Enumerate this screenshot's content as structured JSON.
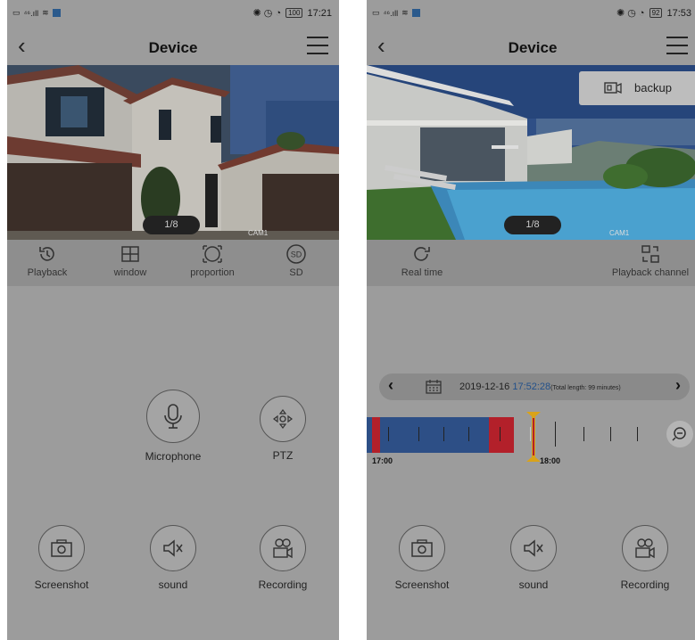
{
  "left": {
    "status_bar": {
      "signal": "⁴⁶.ıll",
      "time": "17:21",
      "battery": "100"
    },
    "title": "Device",
    "overlay": {
      "counter": "1/8",
      "camera": "CAM1"
    },
    "controls": [
      {
        "label": "Playback",
        "icon": "playback-icon"
      },
      {
        "label": "window",
        "icon": "window-grid-icon"
      },
      {
        "label": "proportion",
        "icon": "proportion-icon"
      },
      {
        "label": "SD",
        "icon": "sd-icon"
      }
    ],
    "actions": {
      "microphone": "Microphone",
      "ptz": "PTZ",
      "screenshot": "Screenshot",
      "sound": "sound",
      "recording": "Recording"
    }
  },
  "right": {
    "status_bar": {
      "signal": "⁴⁶.ıll",
      "time": "17:53",
      "battery": "92"
    },
    "title": "Device",
    "popup": {
      "label": "backup",
      "icon": "backup-icon"
    },
    "overlay": {
      "counter": "1/8",
      "camera": "CAM1"
    },
    "controls": [
      {
        "label": "Real time",
        "icon": "real-time-icon"
      },
      {
        "label": "Playback channel",
        "icon": "playback-channel-icon"
      }
    ],
    "timebar": {
      "date": "2019-12-16",
      "time": "17:52:28",
      "total": "(Total length: 99 minutes)"
    },
    "timeline": {
      "labels": [
        "17:00",
        "18:00"
      ],
      "colors": {
        "recorded": "#2d4f86",
        "alarm": "#b3202a",
        "cursor": "#d9a31a"
      }
    },
    "actions": {
      "screenshot": "Screenshot",
      "sound": "sound",
      "recording": "Recording"
    }
  }
}
